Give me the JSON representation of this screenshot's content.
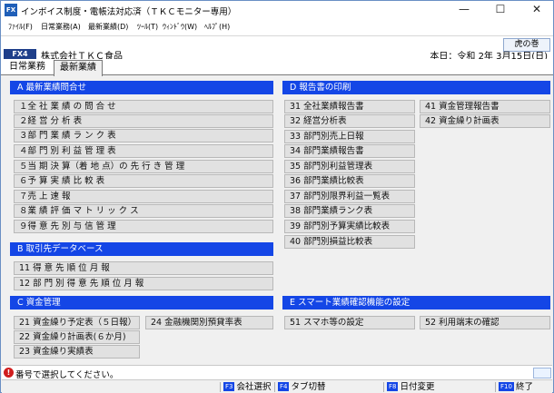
{
  "window": {
    "title": "インボイス制度・電帳法対応済（ＴＫＣモニター専用）",
    "icon_label": "FX",
    "controls": {
      "minimize": "—",
      "maximize": "☐",
      "close": "✕"
    }
  },
  "menubar": [
    "ﾌｧｲﾙ(F)",
    "日常業務(A)",
    "最新業績(D)",
    "ﾂｰﾙ(T)",
    "ｳｨﾝﾄﾞｳ(W)",
    "ﾍﾙﾌﾟ(H)"
  ],
  "infobar": {
    "period_button": "虎の巻",
    "company_code": "FX4",
    "company_name": "株式会社ＴＫＣ食品",
    "today": "本日：令和 2年 3月15日(日)"
  },
  "tabs": [
    {
      "label": "日常業務",
      "active": false
    },
    {
      "label": "最新業績",
      "active": true
    }
  ],
  "sections": {
    "A": {
      "header": "A  最新業績問合せ",
      "items": [
        "１全 社 業 績 の 問 合 せ",
        "２経 営 分 析 表",
        "３部 門 業 績 ラ ン ク 表",
        "４部 門 別 利 益 管 理 表",
        "５当 期 決 算（着 地 点）の 先 行 き 管 理",
        "６予 算 実 績 比 較 表",
        "７売 上 速 報",
        "８業 績 評 価 マ ト リ ッ ク ス",
        "９得 意 先 別 与 信 管 理"
      ]
    },
    "B": {
      "header": "B  取引先データベース",
      "items": [
        "11 得 意 先 順 位 月 報",
        "12 部 門 別 得 意 先 順 位 月 報"
      ]
    },
    "C": {
      "header": "C  資金管理",
      "items_left": [
        "21 資金繰り予定表（５日報）",
        "22 資金繰り計画表(６か月)",
        "23 資金繰り実績表"
      ],
      "items_right": [
        "24 金融機関別預貸率表"
      ]
    },
    "D": {
      "header": "D  報告書の印刷",
      "items_left": [
        "31 全社業績報告書",
        "32 経営分析表",
        "33 部門別売上日報",
        "34 部門業績報告書",
        "35 部門別利益管理表",
        "36 部門業績比較表",
        "37 部門別限界利益一覧表",
        "38 部門業績ランク表",
        "39 部門別予算実績比較表",
        "40 部門別損益比較表"
      ],
      "items_right": [
        "41 資金管理報告書",
        "42 資金繰り計画表"
      ]
    },
    "E": {
      "header": "E  スマート業績確認機能の設定",
      "items": [
        "51 スマホ等の設定",
        "52 利用端末の確認"
      ]
    }
  },
  "status": {
    "icon": "!",
    "message": "番号で選択してください。"
  },
  "fkeys": [
    {
      "key": "F3",
      "label": "会社選択"
    },
    {
      "key": "F4",
      "label": "タブ切替"
    },
    {
      "key": "F8",
      "label": "日付変更"
    },
    {
      "key": "F10",
      "label": "終了"
    }
  ],
  "colors": {
    "section_header": "#1446e6",
    "company_code_bg": "#1f3f8a",
    "status_icon": "#d01d1d"
  }
}
